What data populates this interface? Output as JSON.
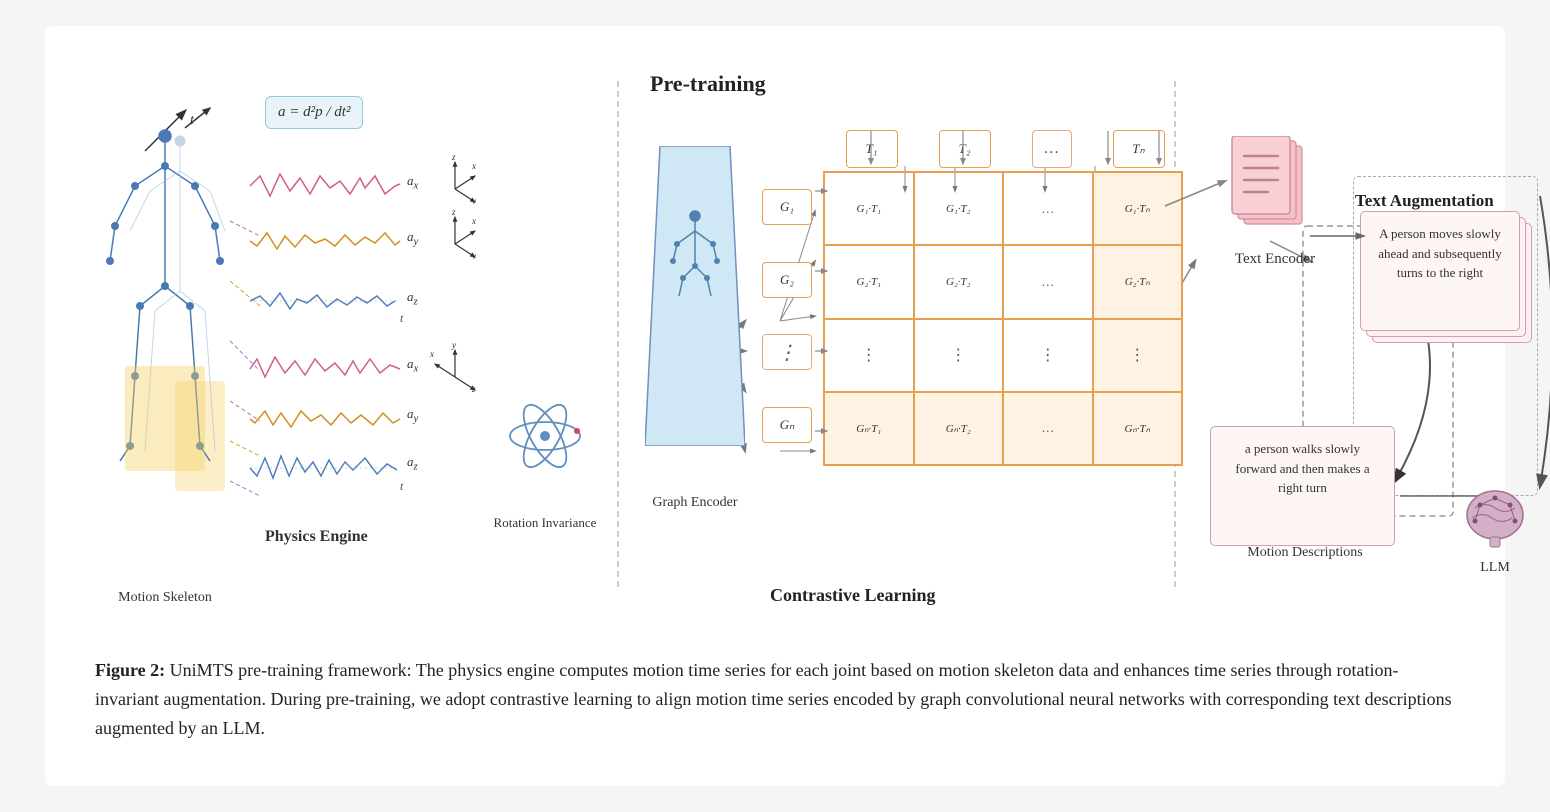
{
  "diagram": {
    "pretraining_label": "Pre-training",
    "contrastive_label": "Contrastive Learning",
    "physics_label": "Physics Engine",
    "motion_skeleton_label": "Motion\nSkeleton",
    "rotation_invariance_label": "Rotation\nInvariance",
    "graph_encoder_label": "Graph\nEncoder",
    "text_encoder_label": "Text\nEncoder",
    "text_augmentation_label": "Text Augmentation",
    "motion_descriptions_label": "Motion Descriptions",
    "llm_label": "LLM",
    "formula": "a = d²p/dt²",
    "formula_display": "a = d²p / dt²",
    "t_label": "t",
    "g_nodes": [
      "G₁",
      "G₂",
      "⋮",
      "Gₙ"
    ],
    "t_tokens": [
      "T₁",
      "T₂",
      "…",
      "Tₙ"
    ],
    "matrix_cells": [
      "G₁·T₁",
      "G₁·T₂",
      "…",
      "G₁·Tₙ",
      "G₂·T₁",
      "G₂·T₂",
      "…",
      "G₂·Tₙ",
      "⋮",
      "⋮",
      "⋮",
      "⋮",
      "Gₙ·T₁",
      "Gₙ·T₂",
      "…",
      "Gₙ·Tₙ"
    ],
    "wave_labels": [
      "aₓ",
      "aᵧ",
      "a_z",
      "aₓ",
      "aᵧ",
      "a_z"
    ],
    "text_desc_top": "A person moves\nslowly ahead and\nsubsequently\nturns to the right",
    "text_desc_bottom": "a person walks\nslowly forward\nand then makes\na right turn",
    "axis_sets": [
      {
        "z": "z",
        "y": "y",
        "x": "x"
      },
      {
        "z": "z",
        "y": "y",
        "x": "x"
      },
      {
        "y": "y",
        "x": "x",
        "z": "z"
      }
    ]
  },
  "caption": {
    "label": "Figure 2:",
    "text": " UniMTS pre-training framework: The physics engine computes motion time series for each joint based on motion skeleton data and enhances time series through rotation-invariant augmentation. During pre-training, we adopt contrastive learning to align motion time series encoded by graph convolutional neural networks with corresponding text descriptions augmented by an LLM."
  },
  "colors": {
    "accent_orange": "#e8a050",
    "accent_pink": "#d4808a",
    "accent_blue": "#6090c0",
    "light_blue": "#a0c0e0",
    "box_bg": "#fdf0f0",
    "formula_bg": "#e8f4f8"
  }
}
